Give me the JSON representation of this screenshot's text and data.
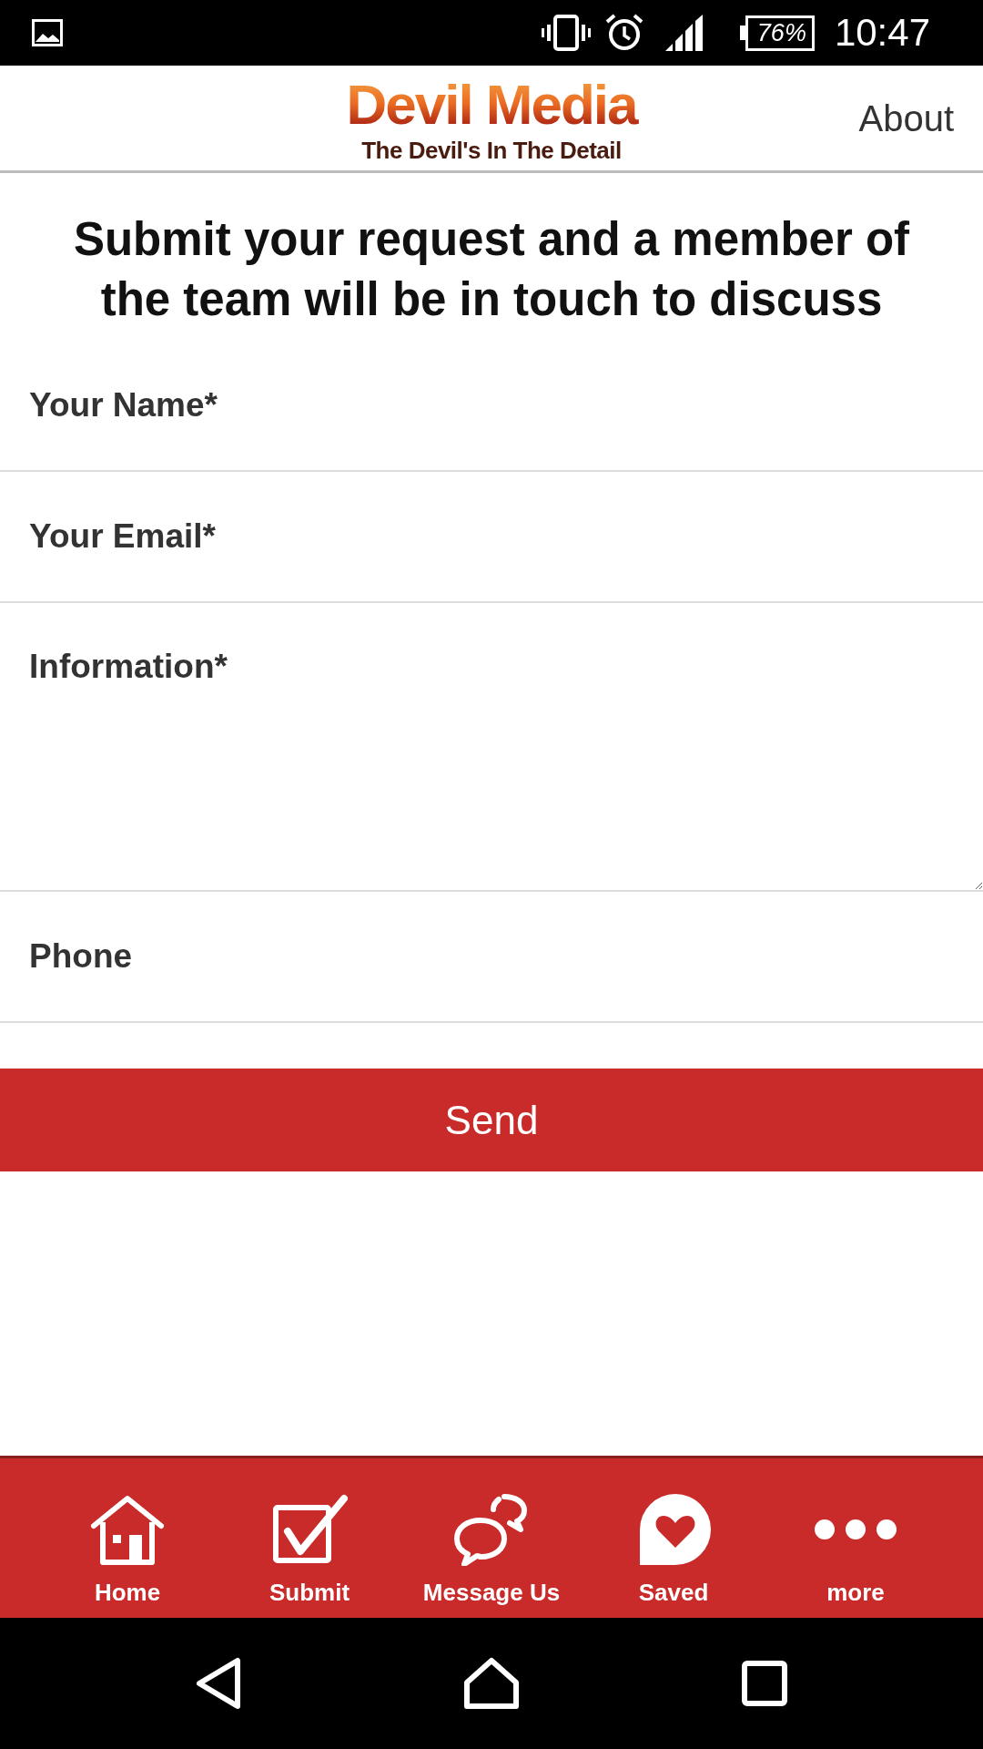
{
  "status_bar": {
    "battery": "76%",
    "time": "10:47"
  },
  "header": {
    "logo_title": "Devil Media",
    "logo_tagline": "The Devil's In The Detail",
    "link": "About"
  },
  "heading": "Submit your request and a member of the team will be in touch to discuss",
  "fields": [
    {
      "kind": "input",
      "placeholder": "Your Name*"
    },
    {
      "kind": "input",
      "placeholder": "Your Email*"
    },
    {
      "kind": "textarea",
      "placeholder": "Information*"
    },
    {
      "kind": "input",
      "placeholder": "Phone"
    }
  ],
  "submit_button": "Send",
  "bottom_nav": [
    {
      "label": "Home"
    },
    {
      "label": "Submit"
    },
    {
      "label": "Message Us"
    },
    {
      "label": "Saved"
    },
    {
      "label": "more"
    }
  ]
}
